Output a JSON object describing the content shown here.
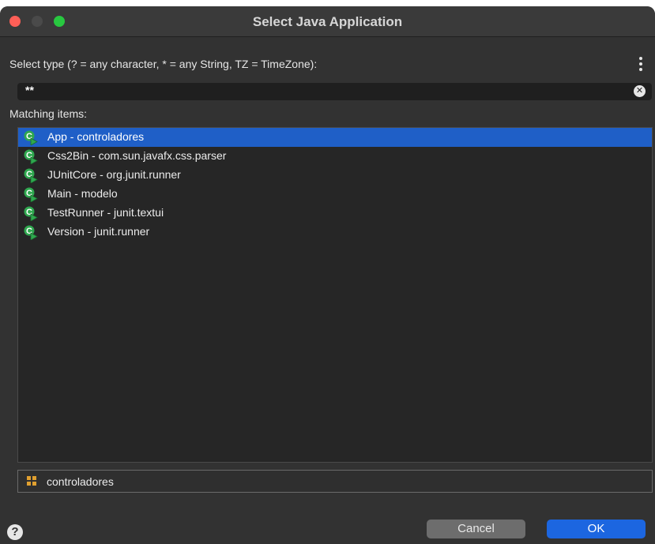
{
  "window": {
    "title": "Select Java Application"
  },
  "prompt": "Select type (? = any character, * = any String, TZ = TimeZone):",
  "filter": {
    "value": "**"
  },
  "matching_label": "Matching items:",
  "items": [
    {
      "label": "App - controladores",
      "selected": true,
      "icon": "java-main-class-icon"
    },
    {
      "label": "Css2Bin - com.sun.javafx.css.parser",
      "selected": false,
      "icon": "java-main-class-icon"
    },
    {
      "label": "JUnitCore - org.junit.runner",
      "selected": false,
      "icon": "java-main-class-icon"
    },
    {
      "label": "Main - modelo",
      "selected": false,
      "icon": "java-main-class-icon"
    },
    {
      "label": "TestRunner - junit.textui",
      "selected": false,
      "icon": "java-main-class-icon"
    },
    {
      "label": "Version - junit.runner",
      "selected": false,
      "icon": "java-main-class-icon"
    }
  ],
  "package": {
    "label": "controladores",
    "icon": "package-icon"
  },
  "buttons": {
    "cancel": "Cancel",
    "ok": "OK",
    "help": "?"
  },
  "colors": {
    "selection": "#1f5fc7",
    "ok_button": "#1c66e0",
    "close": "#ff5f57",
    "zoom": "#28c840",
    "class_icon": "#2fa84f",
    "package_icon": "#e0a030"
  }
}
